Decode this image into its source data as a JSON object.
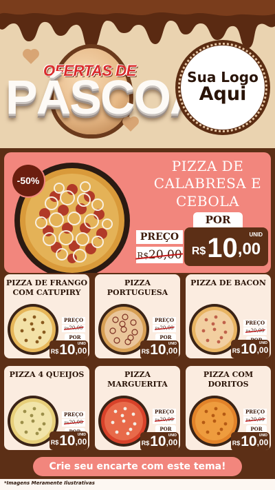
{
  "header": {
    "title_top": "OFERTAS DE",
    "title_main": "PÁSCOA",
    "logo_line1": "Sua Logo",
    "logo_line2": "Aqui"
  },
  "featured": {
    "discount": "-50%",
    "name": "PIZZA DE CALABRESA E CEBOLA",
    "preco_label": "PREÇO",
    "old_currency": "R$",
    "old_price": "20,00",
    "por_label": "POR",
    "unid_label": "UNID",
    "currency": "R$",
    "price_int": "10",
    "price_dec": ",00"
  },
  "products": [
    {
      "name": "PIZZA DE FRANGO COM CATUPIRY",
      "preco_label": "PREÇO",
      "old_currency": "R$",
      "old_price": "20,00",
      "por_label": "POR",
      "unid_label": "UNID",
      "currency": "R$",
      "price_int": "10",
      "price_dec": ",00"
    },
    {
      "name": "PIZZA PORTUGUESA",
      "preco_label": "PREÇO",
      "old_currency": "R$",
      "old_price": "20,00",
      "por_label": "POR",
      "unid_label": "UNID",
      "currency": "R$",
      "price_int": "10",
      "price_dec": ",00"
    },
    {
      "name": "PIZZA DE BACON",
      "preco_label": "PREÇO",
      "old_currency": "R$",
      "old_price": "20,00",
      "por_label": "POR",
      "unid_label": "UNID",
      "currency": "R$",
      "price_int": "10",
      "price_dec": ",00"
    },
    {
      "name": "PIZZA 4 QUEIJOS",
      "preco_label": "PREÇO",
      "old_currency": "R$",
      "old_price": "20,00",
      "por_label": "POR",
      "unid_label": "UNID",
      "currency": "R$",
      "price_int": "10",
      "price_dec": ",00"
    },
    {
      "name": "PIZZA MARGUERITA",
      "preco_label": "PREÇO",
      "old_currency": "R$",
      "old_price": "20,00",
      "por_label": "POR",
      "unid_label": "UNID",
      "currency": "R$",
      "price_int": "10",
      "price_dec": ",00"
    },
    {
      "name": "PIZZA COM DORITOS",
      "preco_label": "PREÇO",
      "old_currency": "R$",
      "old_price": "20,00",
      "por_label": "POR",
      "unid_label": "UNID",
      "currency": "R$",
      "price_int": "10",
      "price_dec": ",00"
    }
  ],
  "footer": {
    "cta": "Crie seu encarte com este tema!",
    "disclaimer": "*Imagens Meramente Ilustrativas"
  },
  "colors": {
    "chocolate": "#5c2f16",
    "salmon": "#f2867d",
    "cream": "#fbece0",
    "beige": "#ead3b0"
  }
}
